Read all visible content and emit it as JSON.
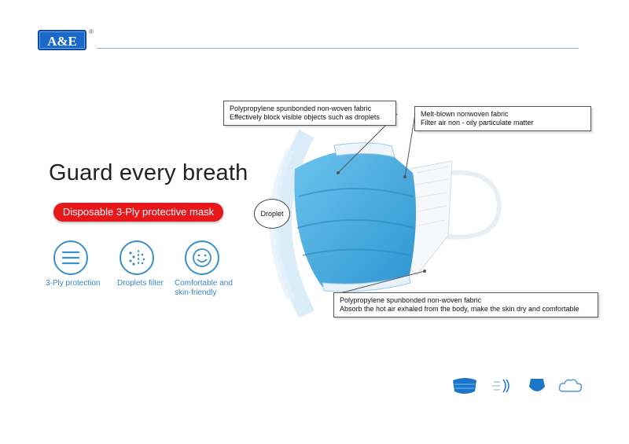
{
  "brand": {
    "logo_text": "A&E",
    "registered_mark": "®"
  },
  "headline": "Guard every breath",
  "tagline": "Disposable 3-Ply protective mask",
  "features": [
    {
      "label": "3-Ply protection",
      "icon": "layers-icon"
    },
    {
      "label": "Droplets filter",
      "icon": "droplets-filter-icon"
    },
    {
      "label": "Comfortable and skin-friendly",
      "label_line1": "Comfortable and",
      "label_line2": "skin-friendly",
      "icon": "smiley-icon"
    }
  ],
  "droplet_label": "Droplet",
  "callouts": {
    "outer_layer": {
      "line1": "Polypropylene spunbonded non-woven fabric",
      "line2": "Effectively block visible objects such as droplets"
    },
    "middle_layer": {
      "line1": "Melt-blown nonwoven fabric",
      "line2": "Filter air non - oily particulate matter"
    },
    "inner_layer": {
      "line1": "Polypropylene spunbonded non-woven fabric",
      "line2": "Absorb the hot air exhaled from the body, make the skin dry and comfortable"
    }
  },
  "colors": {
    "brand_blue": "#1a68c9",
    "accent_red": "#e8171c",
    "icon_blue": "#3b8ec9",
    "mask_blue": "#4fb0e0"
  }
}
